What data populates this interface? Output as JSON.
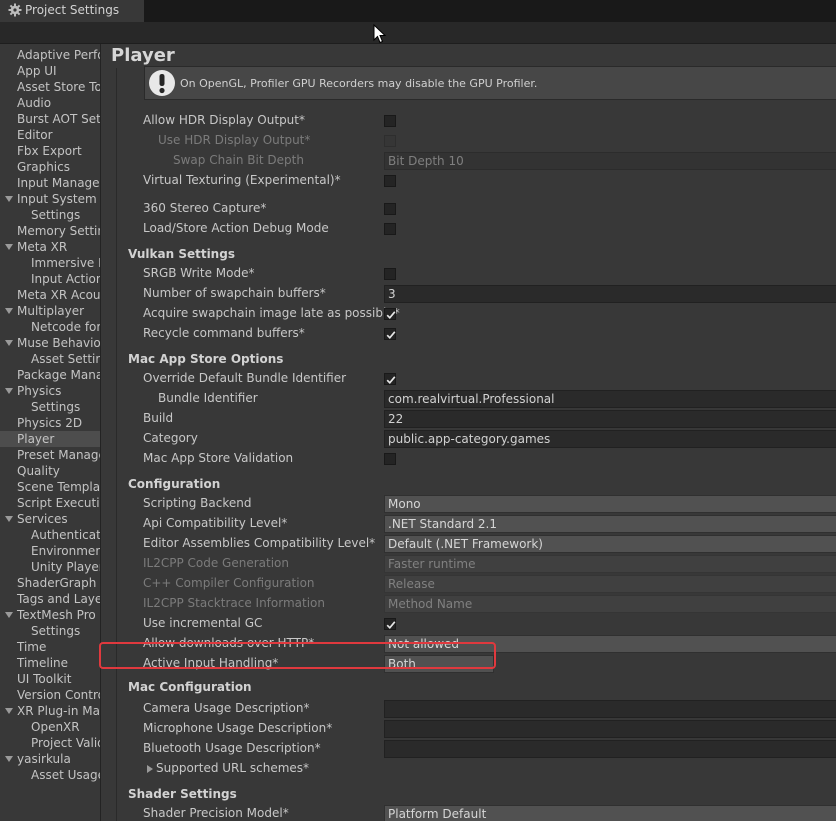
{
  "window": {
    "title": "Project Settings",
    "tab_icon": "gear-icon",
    "accent_highlight": "#e0393e"
  },
  "sidebar": {
    "items": [
      {
        "label": "Adaptive Performance",
        "indent": 0,
        "foldout": false,
        "selected": false
      },
      {
        "label": "App UI",
        "indent": 0,
        "foldout": false,
        "selected": false
      },
      {
        "label": "Asset Store Tools",
        "indent": 0,
        "foldout": false,
        "selected": false
      },
      {
        "label": "Audio",
        "indent": 0,
        "foldout": false,
        "selected": false
      },
      {
        "label": "Burst AOT Settings",
        "indent": 0,
        "foldout": false,
        "selected": false
      },
      {
        "label": "Editor",
        "indent": 0,
        "foldout": false,
        "selected": false
      },
      {
        "label": "Fbx Export",
        "indent": 0,
        "foldout": false,
        "selected": false
      },
      {
        "label": "Graphics",
        "indent": 0,
        "foldout": false,
        "selected": false
      },
      {
        "label": "Input Manager",
        "indent": 0,
        "foldout": false,
        "selected": false
      },
      {
        "label": "Input System Package",
        "indent": 0,
        "foldout": true,
        "selected": false
      },
      {
        "label": "Settings",
        "indent": 1,
        "foldout": false,
        "selected": false
      },
      {
        "label": "Memory Settings",
        "indent": 0,
        "foldout": false,
        "selected": false
      },
      {
        "label": "Meta XR",
        "indent": 0,
        "foldout": true,
        "selected": false
      },
      {
        "label": "Immersive Debugger",
        "indent": 1,
        "foldout": false,
        "selected": false
      },
      {
        "label": "Input Actions",
        "indent": 1,
        "foldout": false,
        "selected": false
      },
      {
        "label": "Meta XR Acoustics",
        "indent": 0,
        "foldout": false,
        "selected": false
      },
      {
        "label": "Multiplayer",
        "indent": 0,
        "foldout": true,
        "selected": false
      },
      {
        "label": "Netcode for GameObjects",
        "indent": 1,
        "foldout": false,
        "selected": false
      },
      {
        "label": "Muse Behavior",
        "indent": 0,
        "foldout": true,
        "selected": false
      },
      {
        "label": "Asset Settings",
        "indent": 1,
        "foldout": false,
        "selected": false
      },
      {
        "label": "Package Manager",
        "indent": 0,
        "foldout": false,
        "selected": false
      },
      {
        "label": "Physics",
        "indent": 0,
        "foldout": true,
        "selected": false
      },
      {
        "label": "Settings",
        "indent": 1,
        "foldout": false,
        "selected": false
      },
      {
        "label": "Physics 2D",
        "indent": 0,
        "foldout": false,
        "selected": false
      },
      {
        "label": "Player",
        "indent": 0,
        "foldout": false,
        "selected": true
      },
      {
        "label": "Preset Manager",
        "indent": 0,
        "foldout": false,
        "selected": false
      },
      {
        "label": "Quality",
        "indent": 0,
        "foldout": false,
        "selected": false
      },
      {
        "label": "Scene Template",
        "indent": 0,
        "foldout": false,
        "selected": false
      },
      {
        "label": "Script Execution Order",
        "indent": 0,
        "foldout": false,
        "selected": false
      },
      {
        "label": "Services",
        "indent": 0,
        "foldout": true,
        "selected": false
      },
      {
        "label": "Authentication",
        "indent": 1,
        "foldout": false,
        "selected": false
      },
      {
        "label": "Environments",
        "indent": 1,
        "foldout": false,
        "selected": false
      },
      {
        "label": "Unity Player Accounts",
        "indent": 1,
        "foldout": false,
        "selected": false
      },
      {
        "label": "ShaderGraph",
        "indent": 0,
        "foldout": false,
        "selected": false
      },
      {
        "label": "Tags and Layers",
        "indent": 0,
        "foldout": false,
        "selected": false
      },
      {
        "label": "TextMesh Pro",
        "indent": 0,
        "foldout": true,
        "selected": false
      },
      {
        "label": "Settings",
        "indent": 1,
        "foldout": false,
        "selected": false
      },
      {
        "label": "Time",
        "indent": 0,
        "foldout": false,
        "selected": false
      },
      {
        "label": "Timeline",
        "indent": 0,
        "foldout": false,
        "selected": false
      },
      {
        "label": "UI Toolkit",
        "indent": 0,
        "foldout": false,
        "selected": false
      },
      {
        "label": "Version Control",
        "indent": 0,
        "foldout": false,
        "selected": false
      },
      {
        "label": "XR Plug-in Management",
        "indent": 0,
        "foldout": true,
        "selected": false
      },
      {
        "label": "OpenXR",
        "indent": 1,
        "foldout": false,
        "selected": false
      },
      {
        "label": "Project Validation",
        "indent": 1,
        "foldout": false,
        "selected": false
      },
      {
        "label": "yasirkula",
        "indent": 0,
        "foldout": true,
        "selected": false
      },
      {
        "label": "Asset Usage Detector",
        "indent": 1,
        "foldout": false,
        "selected": false
      }
    ]
  },
  "main": {
    "title": "Player",
    "help_box": {
      "icon": "warning-icon",
      "message": "On OpenGL, Profiler GPU Recorders may disable the GPU Profiler."
    },
    "rows": [
      {
        "kind": "check",
        "label": "Allow HDR Display Output*",
        "indent": 1,
        "checked": false,
        "disabled": false
      },
      {
        "kind": "check",
        "label": "Use HDR Display Output*",
        "indent": 2,
        "checked": false,
        "disabled": true
      },
      {
        "kind": "field",
        "label": "Swap Chain Bit Depth",
        "indent": 3,
        "value": "Bit Depth 10",
        "disabled": true
      },
      {
        "kind": "check",
        "label": "Virtual Texturing (Experimental)*",
        "indent": 1,
        "checked": false,
        "disabled": false
      },
      {
        "kind": "check",
        "label": "360 Stereo Capture*",
        "indent": 1,
        "checked": false,
        "disabled": false
      },
      {
        "kind": "check",
        "label": "Load/Store Action Debug Mode",
        "indent": 1,
        "checked": false,
        "disabled": false
      },
      {
        "kind": "section",
        "label": "Vulkan Settings"
      },
      {
        "kind": "check",
        "label": "SRGB Write Mode*",
        "indent": 1,
        "checked": false,
        "disabled": false
      },
      {
        "kind": "field",
        "label": "Number of swapchain buffers*",
        "indent": 1,
        "value": "3",
        "disabled": false
      },
      {
        "kind": "check",
        "label": "Acquire swapchain image late as possible*",
        "indent": 1,
        "checked": true,
        "disabled": false
      },
      {
        "kind": "check",
        "label": "Recycle command buffers*",
        "indent": 1,
        "checked": true,
        "disabled": false
      },
      {
        "kind": "section",
        "label": "Mac App Store Options"
      },
      {
        "kind": "check",
        "label": "Override Default Bundle Identifier",
        "indent": 1,
        "checked": true,
        "disabled": false
      },
      {
        "kind": "field",
        "label": "Bundle Identifier",
        "indent": 2,
        "value": "com.realvirtual.Professional",
        "disabled": false
      },
      {
        "kind": "field",
        "label": "Build",
        "indent": 1,
        "value": "22",
        "disabled": false
      },
      {
        "kind": "field",
        "label": "Category",
        "indent": 1,
        "value": "public.app-category.games",
        "disabled": false
      },
      {
        "kind": "check",
        "label": "Mac App Store Validation",
        "indent": 1,
        "checked": false,
        "disabled": false
      },
      {
        "kind": "section",
        "label": "Configuration"
      },
      {
        "kind": "dropdown",
        "label": "Scripting Backend",
        "indent": 1,
        "value": "Mono",
        "disabled": false
      },
      {
        "kind": "dropdown",
        "label": "Api Compatibility Level*",
        "indent": 1,
        "value": ".NET Standard 2.1",
        "disabled": false
      },
      {
        "kind": "dropdown",
        "label": "Editor Assemblies Compatibility Level*",
        "indent": 1,
        "value": "Default (.NET Framework)",
        "disabled": false
      },
      {
        "kind": "dropdown",
        "label": "IL2CPP Code Generation",
        "indent": 1,
        "value": "Faster runtime",
        "disabled": true
      },
      {
        "kind": "dropdown",
        "label": "C++ Compiler Configuration",
        "indent": 1,
        "value": "Release",
        "disabled": true
      },
      {
        "kind": "dropdown",
        "label": "IL2CPP Stacktrace Information",
        "indent": 1,
        "value": "Method Name",
        "disabled": true
      },
      {
        "kind": "check",
        "label": "Use incremental GC",
        "indent": 1,
        "checked": true,
        "disabled": false
      },
      {
        "kind": "dropdown",
        "label": "Allow downloads over HTTP*",
        "indent": 1,
        "value": "Not allowed",
        "disabled": false
      },
      {
        "kind": "dropdown",
        "label": "Active Input Handling*",
        "indent": 1,
        "value": "Both",
        "disabled": false,
        "highlighted": true
      },
      {
        "kind": "section",
        "label": "Mac Configuration"
      },
      {
        "kind": "field",
        "label": "Camera Usage Description*",
        "indent": 1,
        "value": "",
        "disabled": false
      },
      {
        "kind": "field",
        "label": "Microphone Usage Description*",
        "indent": 1,
        "value": "",
        "disabled": false
      },
      {
        "kind": "field",
        "label": "Bluetooth Usage Description*",
        "indent": 1,
        "value": "",
        "disabled": false
      },
      {
        "kind": "foldout",
        "label": "Supported URL schemes*",
        "indent": 1
      },
      {
        "kind": "section",
        "label": "Shader Settings"
      },
      {
        "kind": "dropdown",
        "label": "Shader Precision Model*",
        "indent": 1,
        "value": "Platform Default",
        "disabled": false
      }
    ]
  }
}
